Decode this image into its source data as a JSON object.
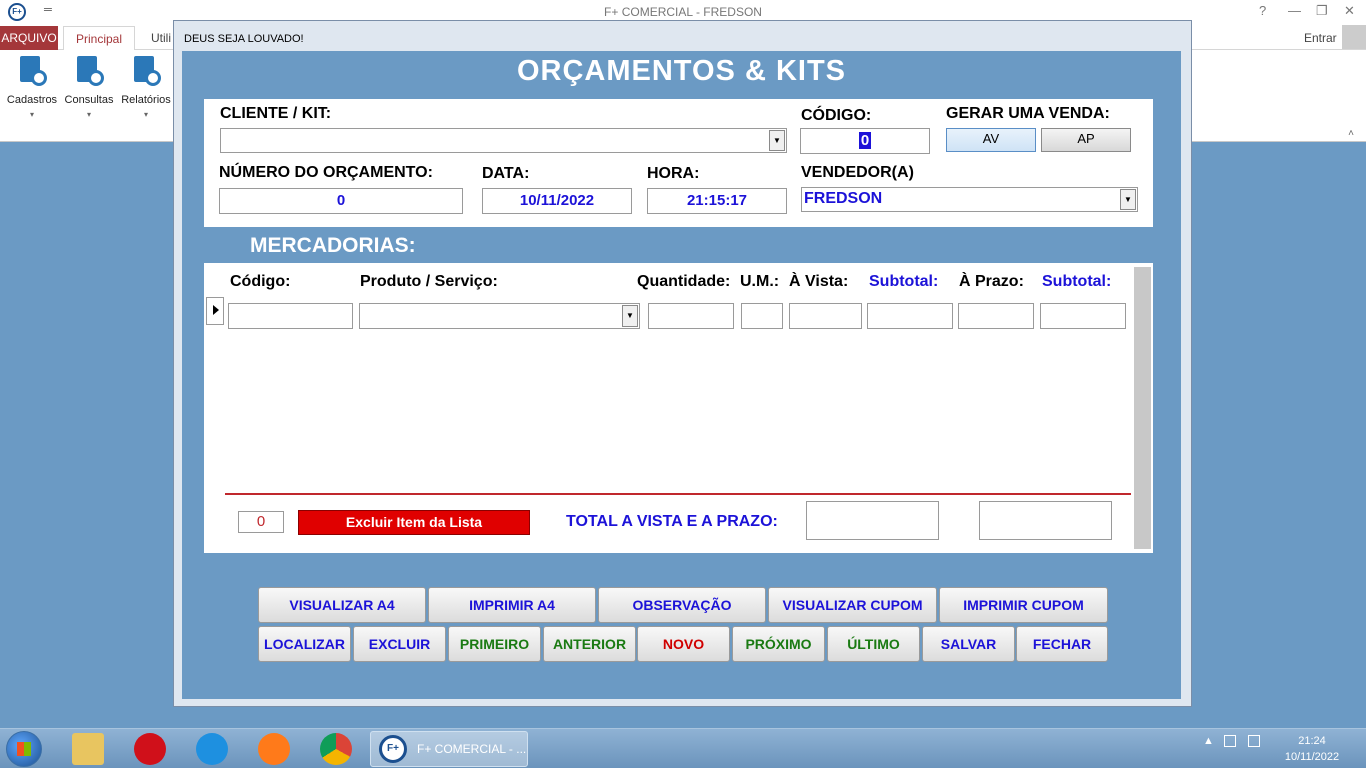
{
  "app": {
    "title": "F+ COMERCIAL - FREDSON",
    "logo": "F+",
    "quick_access": "═",
    "controls": [
      "?",
      "—",
      "❐",
      "✕"
    ]
  },
  "ribbon": {
    "tabs": {
      "arquivo": "ARQUIVO",
      "principal": "Principal",
      "util": "Utili"
    },
    "entrar": "Entrar",
    "buttons": [
      {
        "label": "Cadastros",
        "icon": "cadastros-icon"
      },
      {
        "label": "Consultas",
        "icon": "consultas-icon"
      },
      {
        "label": "Relatórios",
        "icon": "relatorios-icon"
      }
    ],
    "dropdown_glyph": "▾",
    "collapse_glyph": "˄"
  },
  "form": {
    "caption": "DEUS SEJA LOUVADO!",
    "heading": "ORÇAMENTOS & KITS",
    "labels": {
      "cliente": "CLIENTE / KIT:",
      "codigo": "CÓDIGO:",
      "gerar_venda": "GERAR UMA VENDA:",
      "numero": "NÚMERO DO ORÇAMENTO:",
      "data": "DATA:",
      "hora": "HORA:",
      "vendedor": "VENDEDOR(A)",
      "mercadorias": "MERCADORIAS:",
      "total": "TOTAL A VISTA E A PRAZO:"
    },
    "values": {
      "cliente": "",
      "codigo": "0",
      "numero": "0",
      "data": "10/11/2022",
      "hora": "21:15:17",
      "vendedor": "FREDSON",
      "item_count": "0",
      "total_vista": "",
      "total_prazo": ""
    },
    "buttons": {
      "av": "AV",
      "ap": "AP",
      "excluir_item": "Excluir Item da Lista"
    },
    "grid_headers": {
      "codigo": "Código:",
      "produto": "Produto / Serviço:",
      "quantidade": "Quantidade:",
      "um": "U.M.:",
      "avista": "À Vista:",
      "subtotal1": "Subtotal:",
      "aprazo": "À Prazo:",
      "subtotal2": "Subtotal:"
    },
    "combo_arrow": "▼",
    "actions_row1": [
      "VISUALIZAR A4",
      "IMPRIMIR A4",
      "OBSERVAÇÃO",
      "VISUALIZAR CUPOM",
      "IMPRIMIR CUPOM"
    ],
    "actions_row2": [
      "LOCALIZAR",
      "EXCLUIR",
      "PRIMEIRO",
      "ANTERIOR",
      "NOVO",
      "PRÓXIMO",
      "ÚLTIMO",
      "SALVAR",
      "FECHAR"
    ]
  },
  "taskbar": {
    "app_label": "F+ COMERCIAL - ...",
    "app_logo": "F+",
    "time": "21:24",
    "date": "10/11/2022",
    "tray": "▲"
  }
}
